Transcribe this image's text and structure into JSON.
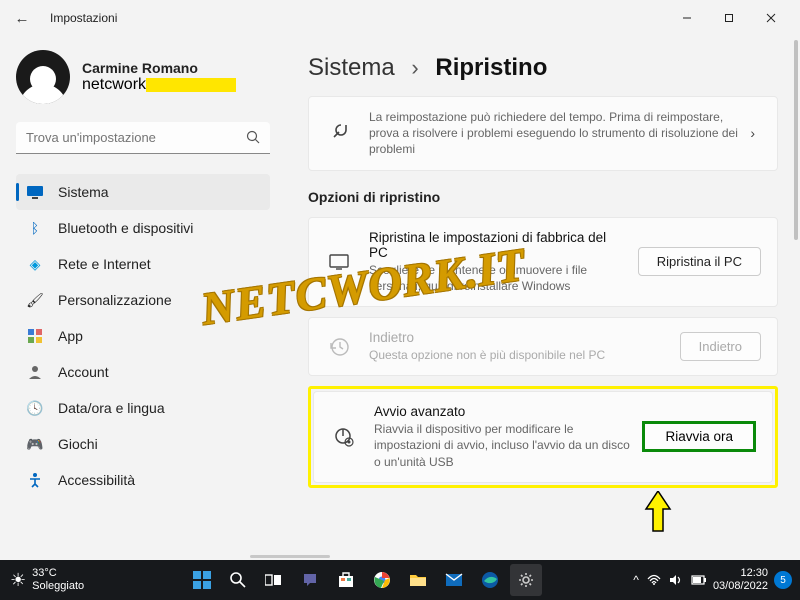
{
  "titlebar": {
    "title": "Impostazioni"
  },
  "profile": {
    "name": "Carmine Romano",
    "email_prefix": "netcwork"
  },
  "search": {
    "placeholder": "Trova un'impostazione"
  },
  "nav": [
    {
      "label": "Sistema",
      "active": true
    },
    {
      "label": "Bluetooth e dispositivi"
    },
    {
      "label": "Rete e Internet"
    },
    {
      "label": "Personalizzazione"
    },
    {
      "label": "App"
    },
    {
      "label": "Account"
    },
    {
      "label": "Data/ora e lingua"
    },
    {
      "label": "Giochi"
    },
    {
      "label": "Accessibilità"
    }
  ],
  "breadcrumb": {
    "parent": "Sistema",
    "current": "Ripristino"
  },
  "troubleshoot": {
    "desc": "La reimpostazione può richiedere del tempo. Prima di reimpostare, prova a risolvere i problemi eseguendo lo strumento di risoluzione dei problemi"
  },
  "section_header": "Opzioni di ripristino",
  "reset": {
    "title": "Ripristina le impostazioni di fabbrica del PC",
    "desc": "Scegliere se mantenere o rimuovere i file personali, quindi reinstallare Windows",
    "button": "Ripristina il PC"
  },
  "goback": {
    "title": "Indietro",
    "desc": "Questa opzione non è più disponibile nel PC",
    "button": "Indietro"
  },
  "advanced": {
    "title": "Avvio avanzato",
    "desc": "Riavvia il dispositivo per modificare le impostazioni di avvio, incluso l'avvio da un disco o un'unità USB",
    "button": "Riavvia ora"
  },
  "watermark": "NETCWORK.IT",
  "taskbar": {
    "temp": "33°C",
    "weather": "Soleggiato",
    "time": "12:30",
    "date": "03/08/2022",
    "notif_count": "5"
  }
}
